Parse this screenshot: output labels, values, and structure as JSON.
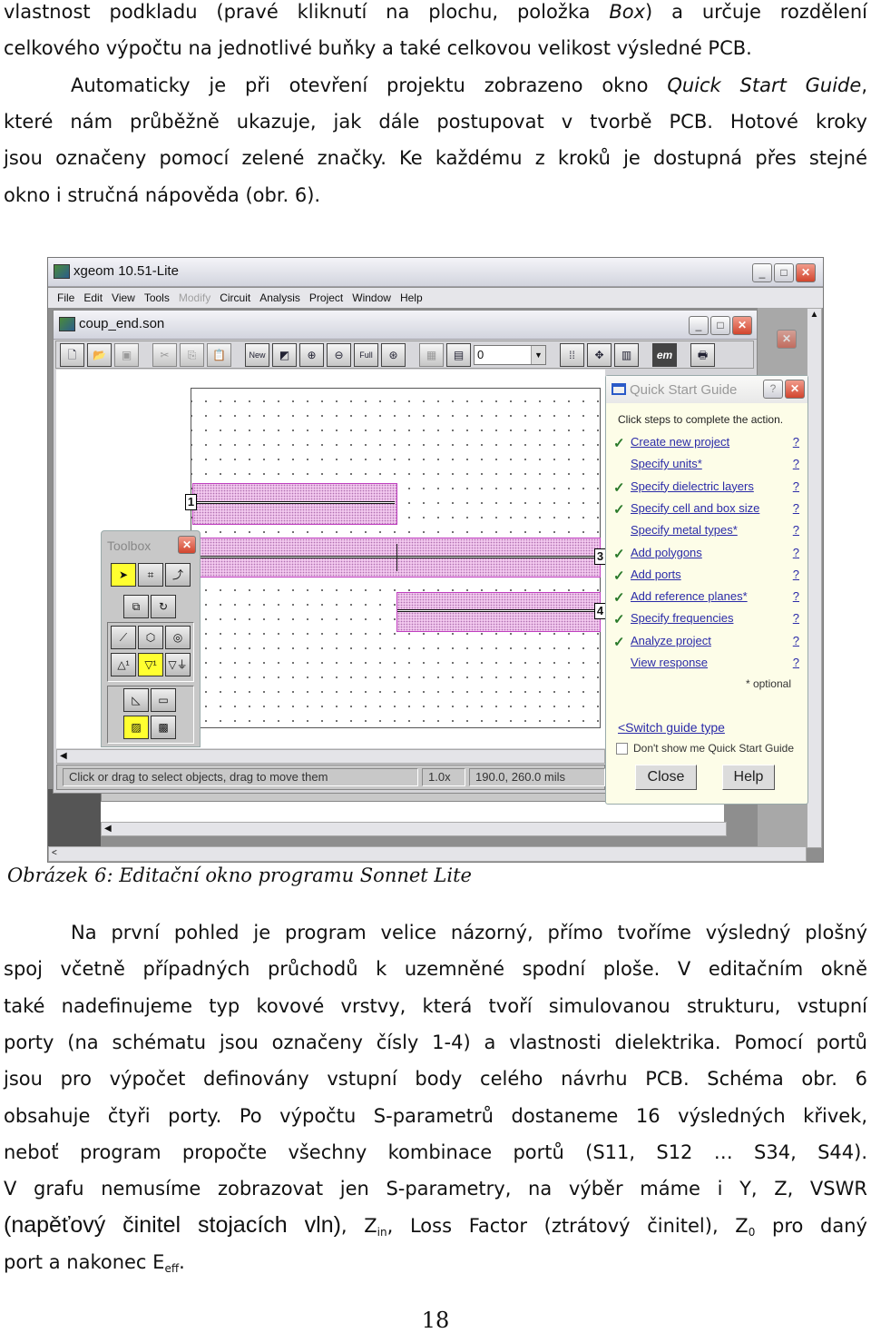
{
  "paragraph1": [
    {
      "cls": "",
      "segs": [
        {
          "t": "vlastnost podkladu (pravé kliknutí na plochu, položka "
        },
        {
          "t": "Box",
          "i": true
        },
        {
          "t": ") a určuje rozdělení"
        }
      ]
    },
    {
      "cls": "last",
      "segs": [
        {
          "t": "celkového výpočtu na jednotlivé buňky a také celkovou velikost výsledné PCB."
        }
      ]
    },
    {
      "cls": "ind",
      "segs": [
        {
          "t": "Automaticky je při otevření projektu zobrazeno okno "
        },
        {
          "t": "Quick Start Guide",
          "i": true
        },
        {
          "t": ","
        }
      ]
    },
    {
      "cls": "",
      "segs": [
        {
          "t": "které nám průběžně ukazuje, jak dále postupovat v tvorbě PCB. Hotové kroky"
        }
      ]
    },
    {
      "cls": "",
      "segs": [
        {
          "t": "jsou označeny pomocí zelené značky. Ke každému z kroků je dostupná přes stejné"
        }
      ]
    },
    {
      "cls": "last",
      "segs": [
        {
          "t": "okno i stručná nápověda (obr. 6)."
        }
      ]
    }
  ],
  "caption": "Obrázek 6: Editační okno programu Sonnet Lite",
  "paragraph2": [
    {
      "cls": "ind",
      "segs": [
        {
          "t": "Na první pohled je program velice názorný, přímo tvoříme výsledný plošný"
        }
      ]
    },
    {
      "cls": "",
      "segs": [
        {
          "t": "spoj včetně případných průchodů k uzemněné spodní ploše. V editačním okně"
        }
      ]
    },
    {
      "cls": "",
      "segs": [
        {
          "t": "také nadefinujeme typ kovové vrstvy, která tvoří simulovanou strukturu, vstupní"
        }
      ]
    },
    {
      "cls": "",
      "segs": [
        {
          "t": "porty (na schématu jsou označeny čísly 1-4) a vlastnosti dielektrika. Pomocí portů"
        }
      ]
    },
    {
      "cls": "",
      "segs": [
        {
          "t": "jsou pro výpočet definovány vstupní body celého návrhu PCB. Schéma obr. 6"
        }
      ]
    },
    {
      "cls": "",
      "segs": [
        {
          "t": "obsahuje čtyři porty. Po výpočtu S-parametrů dostaneme 16 výsledných křivek,"
        }
      ]
    },
    {
      "cls": "",
      "segs": [
        {
          "t": "neboť program propočte všechny kombinace portů (S11, S12 … S34, S44)."
        }
      ]
    },
    {
      "cls": "",
      "segs": [
        {
          "t": "V grafu nemusíme zobrazovat jen S-parametry, na výběr máme i Y, Z, VSWR"
        }
      ]
    },
    {
      "cls": "",
      "segs": [
        {
          "t": "(napěťový činitel stojacích vln)",
          "big": true
        },
        {
          "t": ", Z"
        },
        {
          "t": "in",
          "sub": true
        },
        {
          "t": ", Loss Factor (ztrátový činitel), Z"
        },
        {
          "t": "0",
          "sub": true
        },
        {
          "t": " pro daný"
        }
      ]
    },
    {
      "cls": "last",
      "segs": [
        {
          "t": "port a nakonec  E"
        },
        {
          "t": "eff",
          "sub": true
        },
        {
          "t": "."
        }
      ]
    }
  ],
  "page_number": "18",
  "app": {
    "title": "xgeom 10.51-Lite",
    "menu": [
      {
        "label": "File",
        "enabled": true
      },
      {
        "label": "Edit",
        "enabled": true
      },
      {
        "label": "View",
        "enabled": true
      },
      {
        "label": "Tools",
        "enabled": true
      },
      {
        "label": "Modify",
        "enabled": false
      },
      {
        "label": "Circuit",
        "enabled": true
      },
      {
        "label": "Analysis",
        "enabled": true
      },
      {
        "label": "Project",
        "enabled": true
      },
      {
        "label": "Window",
        "enabled": true
      },
      {
        "label": "Help",
        "enabled": true
      }
    ],
    "document_title": "coup_end.son",
    "toolbar": {
      "level_value": "0",
      "new_label": "New",
      "full_label": "Full",
      "emi_label": "em"
    },
    "ports": [
      "1",
      "3",
      "4"
    ],
    "status": {
      "message": "Click or drag to select objects, drag to move them",
      "zoom": "1.0x",
      "coords": "190.0, 260.0 mils"
    },
    "toolbox_title": "Toolbox",
    "quick_start": {
      "title": "Quick Start Guide",
      "instruction": "Click steps to complete the action.",
      "steps": [
        {
          "label": "Create new project",
          "done": true
        },
        {
          "label": "Specify units*",
          "done": false
        },
        {
          "label": "Specify dielectric layers",
          "done": true
        },
        {
          "label": "Specify cell and box size",
          "done": true
        },
        {
          "label": "Specify metal types*",
          "done": false
        },
        {
          "label": "Add polygons",
          "done": true
        },
        {
          "label": "Add ports",
          "done": true
        },
        {
          "label": "Add reference planes*",
          "done": true
        },
        {
          "label": "Specify frequencies",
          "done": true
        },
        {
          "label": "Analyze project",
          "done": true
        },
        {
          "label": "View response",
          "done": false
        }
      ],
      "help_mark": "?",
      "optional_note": "* optional",
      "switch_link": "<Switch guide type",
      "dont_show_label": "Don't show me Quick Start Guide",
      "dont_show_checked": false,
      "close_label": "Close",
      "help_label": "Help",
      "check_color": "#2a7a2a",
      "link_color": "#2a2aa8"
    }
  }
}
